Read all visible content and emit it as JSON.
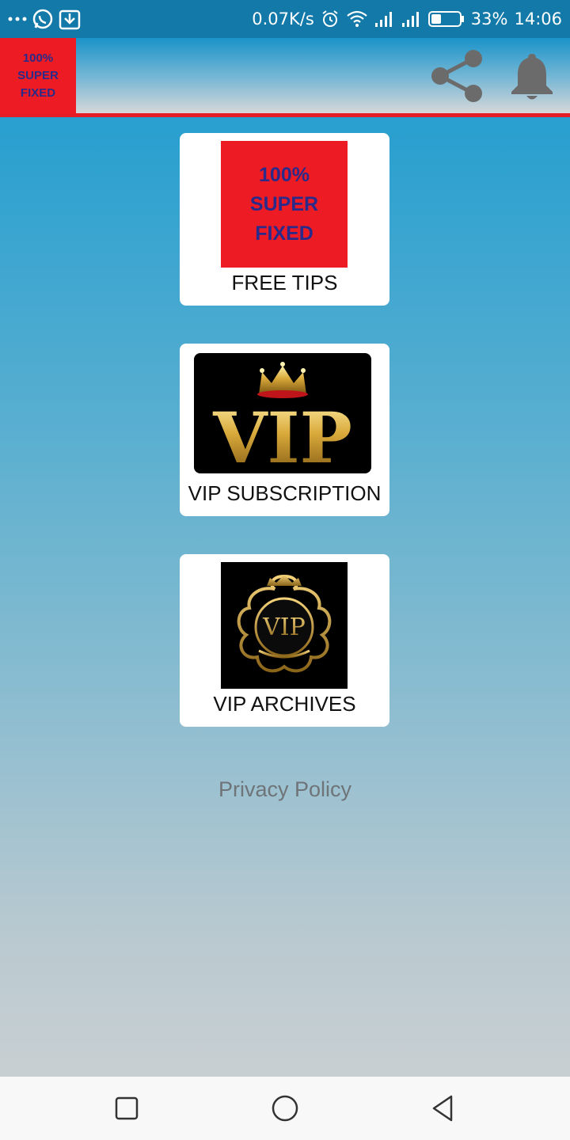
{
  "status_bar": {
    "net_speed": "0.07K/s",
    "battery": "33%",
    "time": "14:06",
    "icons": [
      "more-dots-icon",
      "whatsapp-icon",
      "download-icon",
      "alarm-icon",
      "wifi-icon",
      "signal-icon",
      "signal-icon",
      "battery-icon"
    ]
  },
  "header": {
    "logo_lines": [
      "100%",
      "SUPER",
      "FIXED"
    ],
    "share_icon": "share-icon",
    "bell_icon": "bell-icon"
  },
  "cards": [
    {
      "label": "FREE TIPS",
      "image_lines": [
        "100%",
        "SUPER",
        "FIXED"
      ]
    },
    {
      "label": "VIP SUBSCRIPTION",
      "image_text": "VIP"
    },
    {
      "label": "VIP ARCHIVES",
      "image_text": "VIP"
    }
  ],
  "footer": {
    "privacy_label": "Privacy Policy"
  },
  "nav": {
    "icons": [
      "recents-square-icon",
      "home-circle-icon",
      "back-triangle-icon"
    ]
  },
  "colors": {
    "red": "#ed1c24",
    "blue": "#1599cf",
    "navy_text": "#2a2a8a",
    "gold": "#d4a93a"
  }
}
